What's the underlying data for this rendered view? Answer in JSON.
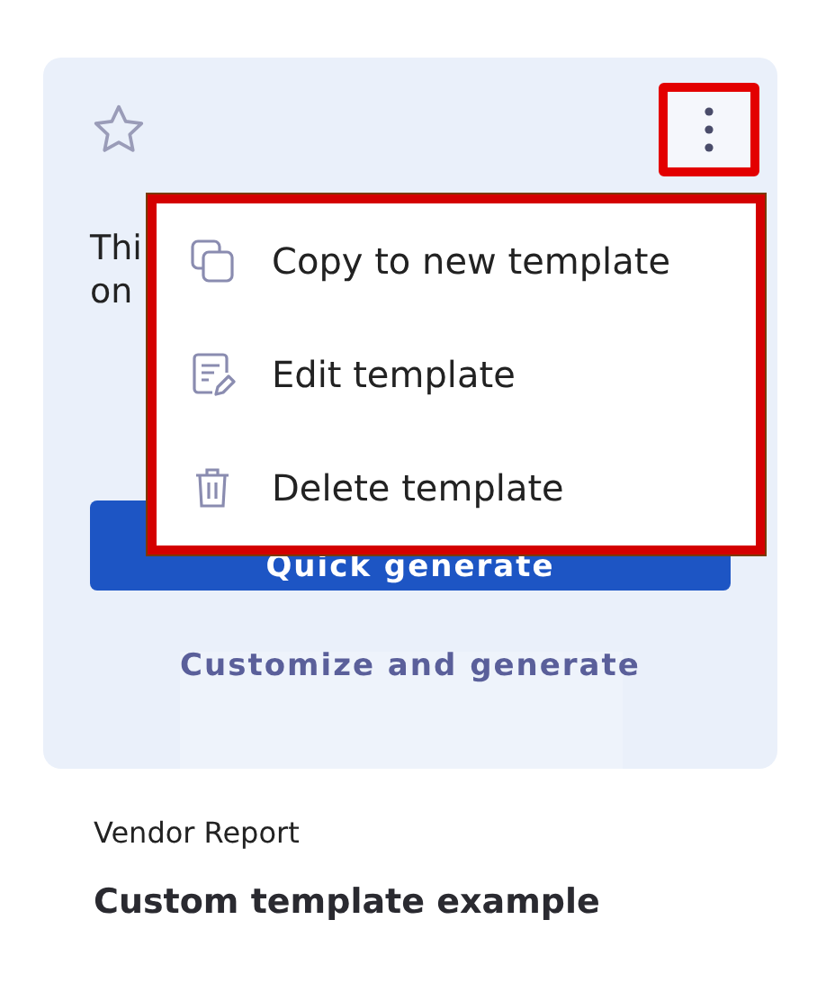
{
  "card": {
    "starred": false,
    "description_lines": [
      "Thi",
      "on"
    ],
    "primary_button": "Quick generate",
    "secondary_link": "Customize and generate",
    "menu": {
      "open": true,
      "items": [
        {
          "kind": "copy",
          "label": "Copy to new template"
        },
        {
          "kind": "edit",
          "label": "Edit template"
        },
        {
          "kind": "delete",
          "label": "Delete template"
        }
      ]
    }
  },
  "category": "Vendor Report",
  "title": "Custom template example"
}
